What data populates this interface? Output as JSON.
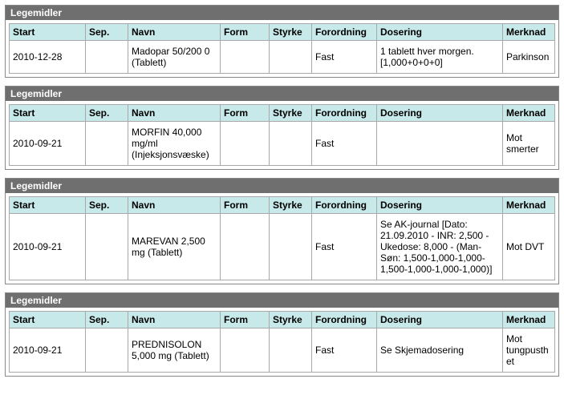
{
  "headers": {
    "start": "Start",
    "sep": "Sep.",
    "navn": "Navn",
    "form": "Form",
    "styrke": "Styrke",
    "forordning": "Forordning",
    "dosering": "Dosering",
    "merknad": "Merknad"
  },
  "panel_title": "Legemidler",
  "sections": [
    {
      "row": {
        "start": "2010-12-28",
        "sep": "",
        "navn": "Madopar 50/200 0 (Tablett)",
        "form": "",
        "styrke": "",
        "forordning": "Fast",
        "dosering": "1 tablett hver morgen. [1,000+0+0+0]",
        "merknad": "Parkinson"
      }
    },
    {
      "row": {
        "start": "2010-09-21",
        "sep": "",
        "navn": "MORFIN 40,000 mg/ml (Injeksjonsvæske)",
        "form": "",
        "styrke": "",
        "forordning": "Fast",
        "dosering": "",
        "merknad": "Mot smerter"
      }
    },
    {
      "row": {
        "start": "2010-09-21",
        "sep": "",
        "navn": "MAREVAN 2,500 mg (Tablett)",
        "form": "",
        "styrke": "",
        "forordning": "Fast",
        "dosering": "Se AK-journal [Dato: 21.09.2010 - INR: 2,500 - Ukedose: 8,000 - (Man-Søn: 1,500-1,000-1,000-1,500-1,000-1,000-1,000)]",
        "merknad": "Mot DVT"
      }
    },
    {
      "row": {
        "start": "2010-09-21",
        "sep": "",
        "navn": "PREDNISOLON 5,000 mg (Tablett)",
        "form": "",
        "styrke": "",
        "forordning": "Fast",
        "dosering": "Se Skjemadosering",
        "merknad": "Mot tungpusthet"
      }
    }
  ]
}
